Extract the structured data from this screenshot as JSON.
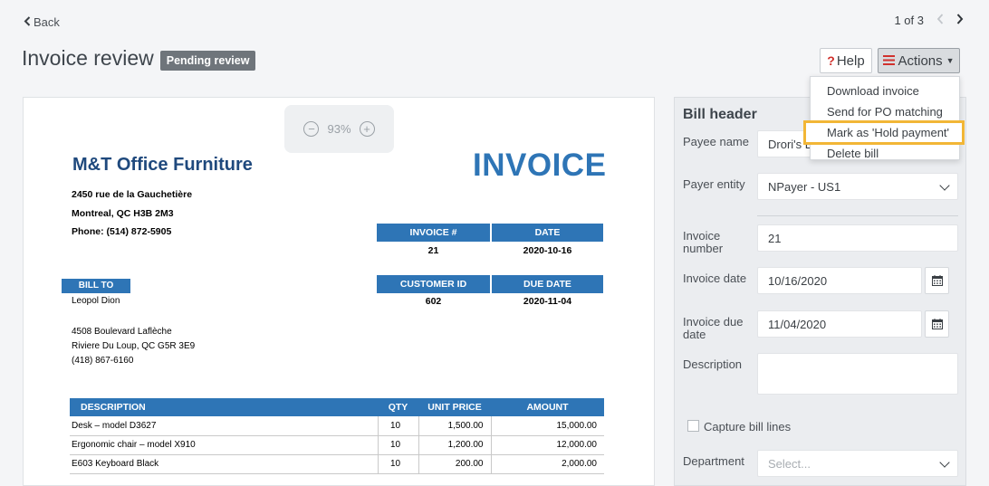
{
  "nav": {
    "back_label": "Back",
    "pager_text": "1 of 3"
  },
  "header": {
    "title": "Invoice review",
    "status_badge": "Pending review"
  },
  "toolbar": {
    "help_label": "Help",
    "help_icon": "?",
    "actions_label": "Actions"
  },
  "actions_menu": {
    "items": [
      "Download invoice",
      "Send for PO matching",
      "Mark as 'Hold payment'",
      "Delete bill"
    ],
    "highlighted": "Mark as 'Hold payment'"
  },
  "viewer": {
    "zoom": "93%"
  },
  "invoice": {
    "company": "M&T Office Furniture",
    "doc_title": "INVOICE",
    "address": [
      "2450 rue de la Gauchetière",
      "Montreal, QC H3B 2M3",
      "Phone: (514) 872-5905"
    ],
    "invoice_no_label": "INVOICE #",
    "invoice_no": "21",
    "date_label": "DATE",
    "date": "2020-10-16",
    "customer_id_label": "CUSTOMER ID",
    "customer_id": "602",
    "due_date_label": "DUE DATE",
    "due_date": "2020-11-04",
    "bill_to_label": "BILL TO",
    "bill_to_name": "Leopol Dion",
    "bill_to_address": [
      "4508 Boulevard Laflèche",
      "Riviere Du Loup, QC G5R 3E9",
      "(418) 867-6160"
    ],
    "columns": [
      "DESCRIPTION",
      "QTY",
      "UNIT PRICE",
      "AMOUNT"
    ],
    "lines": [
      [
        "Desk – model D3627",
        "10",
        "1,500.00",
        "15,000.00"
      ],
      [
        "Ergonomic chair – model X910",
        "10",
        "1,200.00",
        "12,000.00"
      ],
      [
        "E603 Keyboard Black",
        "10",
        "200.00",
        "2,000.00"
      ]
    ]
  },
  "bill_header": {
    "title": "Bill header",
    "payee_label": "Payee name",
    "payee_value": "Drori's L",
    "payer_label": "Payer entity",
    "payer_value": "NPayer - US1",
    "invoice_number_label_1": "Invoice",
    "invoice_number_label_2": "number",
    "invoice_number_value": "21",
    "invoice_date_label": "Invoice date",
    "invoice_date_value": "10/16/2020",
    "due_date_label_1": "Invoice due",
    "due_date_label_2": "date",
    "due_date_value": "11/04/2020",
    "description_label": "Description",
    "description_value": "",
    "capture_lines_label": "Capture bill lines",
    "department_label": "Department",
    "department_placeholder": "Select..."
  }
}
